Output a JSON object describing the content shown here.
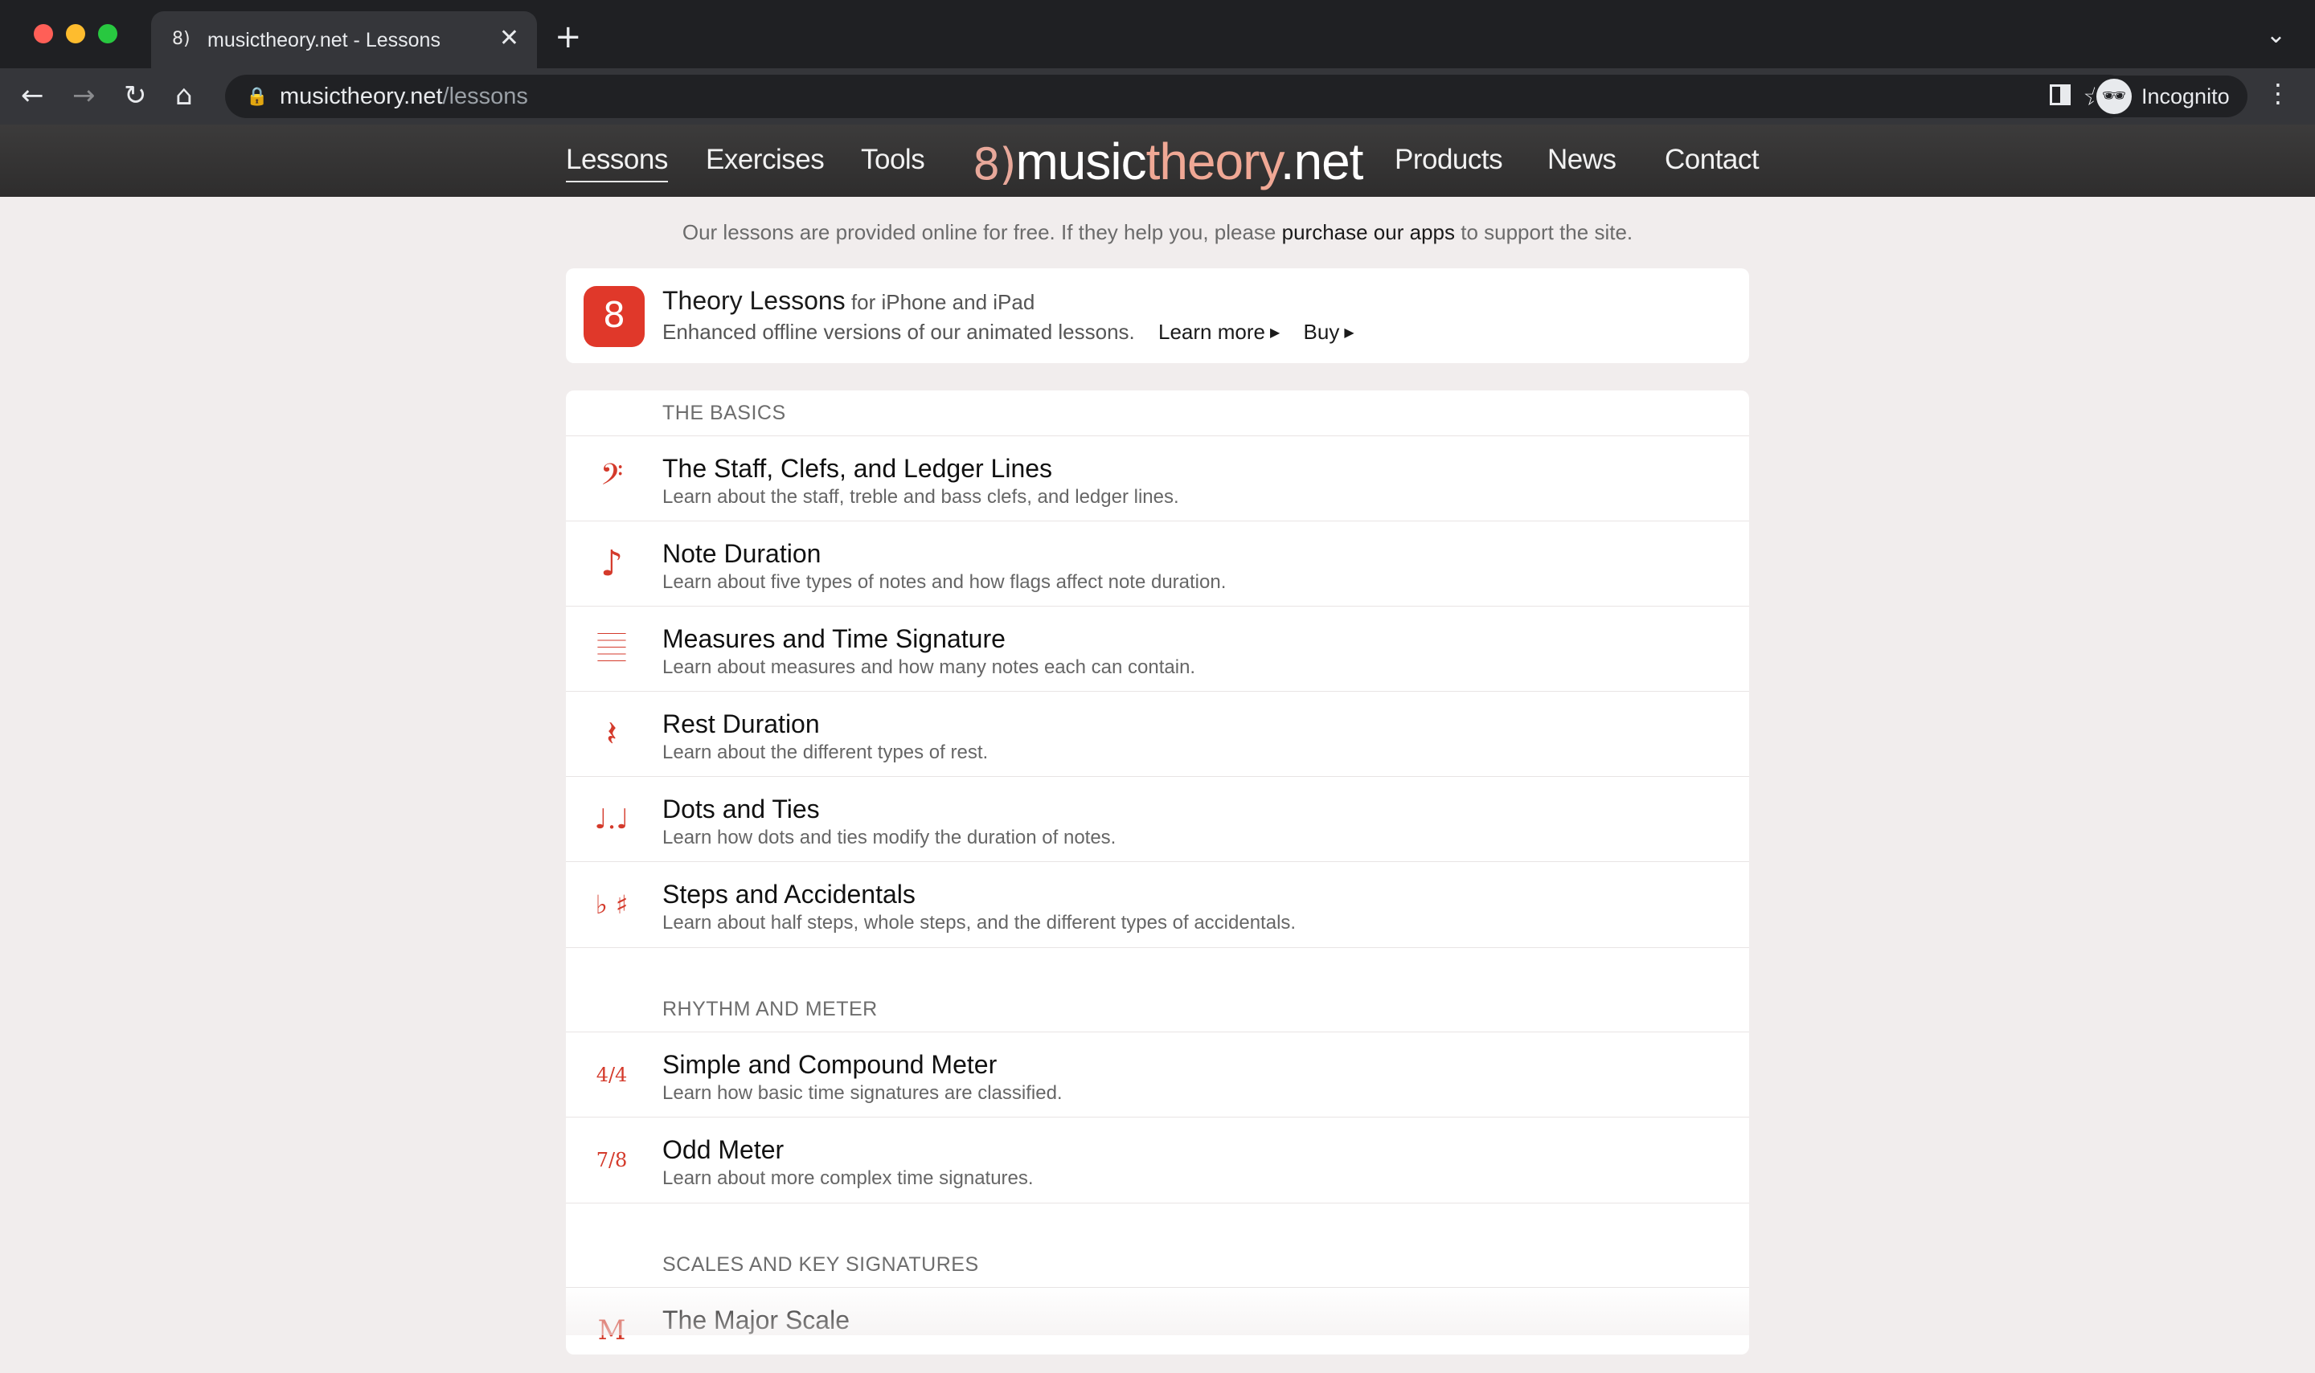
{
  "browser": {
    "tab_title": "musictheory.net - Lessons",
    "tab_favicon": "8)",
    "close_glyph": "✕",
    "new_tab_glyph": "+",
    "tab_menu_glyph": "⌄",
    "url_host": "musictheory.net",
    "url_path": "/lessons",
    "profile_label": "Incognito",
    "back_glyph": "←",
    "forward_glyph": "→",
    "reload_glyph": "↻",
    "home_glyph": "⌂",
    "lock_glyph": "🔒",
    "star_glyph": "☆",
    "kebab_glyph": "⋮",
    "incognito_glyph": "🕶"
  },
  "nav": {
    "lessons": "Lessons",
    "exercises": "Exercises",
    "tools": "Tools",
    "logo_mark": "8)",
    "logo_w1": "music",
    "logo_w2": "theory",
    "logo_w3": ".net",
    "products": "Products",
    "news": "News",
    "contact": "Contact"
  },
  "intro": {
    "before": "Our lessons are provided online for free. If they help you, please ",
    "link": "purchase our apps",
    "after": " to support the site."
  },
  "promo": {
    "icon_glyph": "8",
    "title": "Theory Lessons",
    "subtitle": " for iPhone and iPad",
    "description": "Enhanced offline versions of our animated lessons.",
    "learn_more": "Learn more",
    "buy": "Buy",
    "arrow": "▶"
  },
  "sections": {
    "basics": "THE BASICS",
    "rhythm": "RHYTHM AND METER",
    "scales": "SCALES AND KEY SIGNATURES"
  },
  "lessons": [
    {
      "icon": "𝄢",
      "title": "The Staff, Clefs, and Ledger Lines",
      "desc": "Learn about the staff, treble and bass clefs, and ledger lines."
    },
    {
      "icon": "♪",
      "title": "Note Duration",
      "desc": "Learn about five types of notes and how flags affect note duration."
    },
    {
      "icon": "𝄚",
      "title": "Measures and Time Signature",
      "desc": "Learn about measures and how many notes each can contain."
    },
    {
      "icon": "𝄽",
      "title": "Rest Duration",
      "desc": "Learn about the different types of rest."
    },
    {
      "icon": "♩.♩",
      "title": "Dots and Ties",
      "desc": "Learn how dots and ties modify the duration of notes."
    },
    {
      "icon": "♭ ♯",
      "title": "Steps and Accidentals",
      "desc": "Learn about half steps, whole steps, and the different types of accidentals."
    },
    {
      "icon": "4/4",
      "title": "Simple and Compound Meter",
      "desc": "Learn how basic time signatures are classified."
    },
    {
      "icon": "7/8",
      "title": "Odd Meter",
      "desc": "Learn about more complex time signatures."
    },
    {
      "icon": "M",
      "title": "The Major Scale",
      "desc": ""
    }
  ]
}
